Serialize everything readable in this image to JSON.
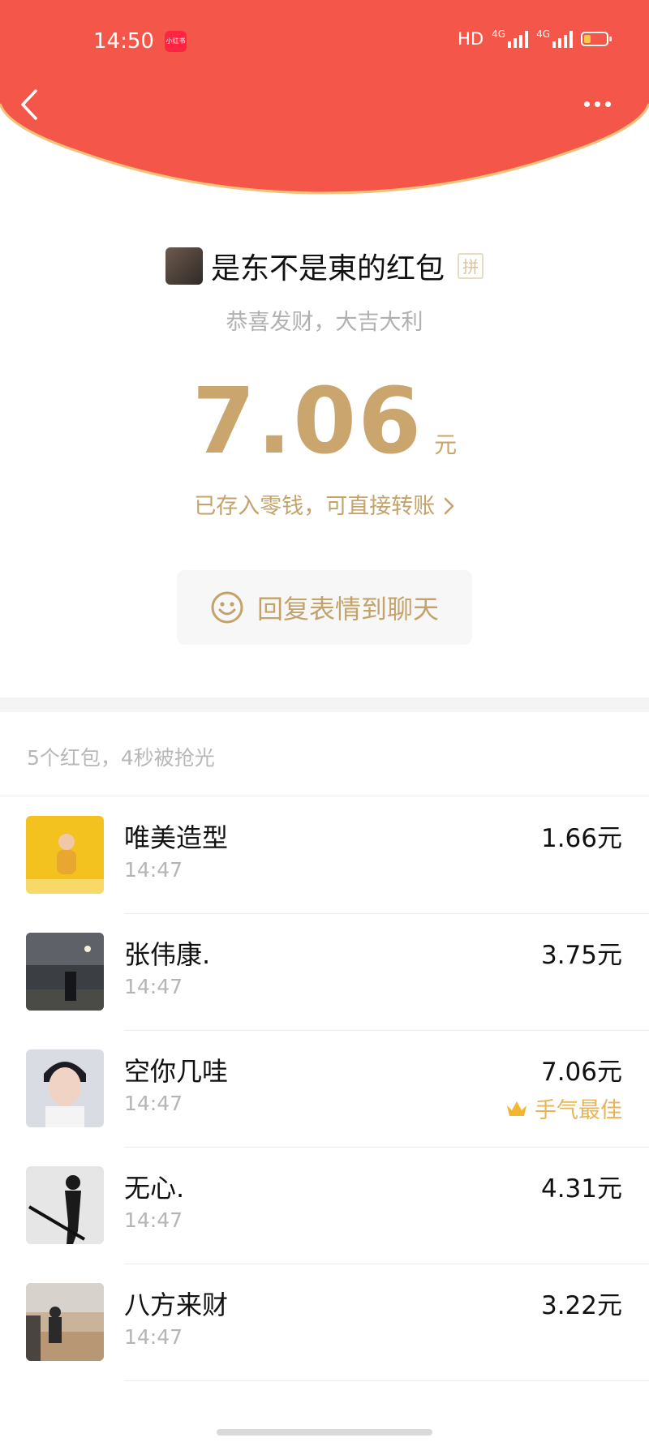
{
  "status_bar": {
    "time": "14:50",
    "app_badge": "小红书",
    "hd": "HD",
    "network_1": "4G",
    "network_2": "4G"
  },
  "header": {
    "back_icon": "chevron-left-icon",
    "more_icon": "more-dots-icon",
    "bg_color": "#f4574a",
    "rim_color": "#f0c27a"
  },
  "packet": {
    "sender_title": "是东不是東的红包",
    "pin_tag": "拼",
    "blessing": "恭喜发财，大吉大利",
    "amount": "7.06",
    "unit": "元",
    "change_link": "已存入零钱，可直接转账",
    "reply_label": "回复表情到聊天",
    "accent_color": "#caa66e"
  },
  "summary": "5个红包，4秒被抢光",
  "records": [
    {
      "name": "唯美造型",
      "time": "14:47",
      "amount": "1.66元"
    },
    {
      "name": "张伟康.",
      "time": "14:47",
      "amount": "3.75元"
    },
    {
      "name": "空你几哇",
      "time": "14:47",
      "amount": "7.06元",
      "best": "手气最佳"
    },
    {
      "name": "无心.",
      "time": "14:47",
      "amount": "4.31元"
    },
    {
      "name": "八方来财",
      "time": "14:47",
      "amount": "3.22元"
    }
  ]
}
